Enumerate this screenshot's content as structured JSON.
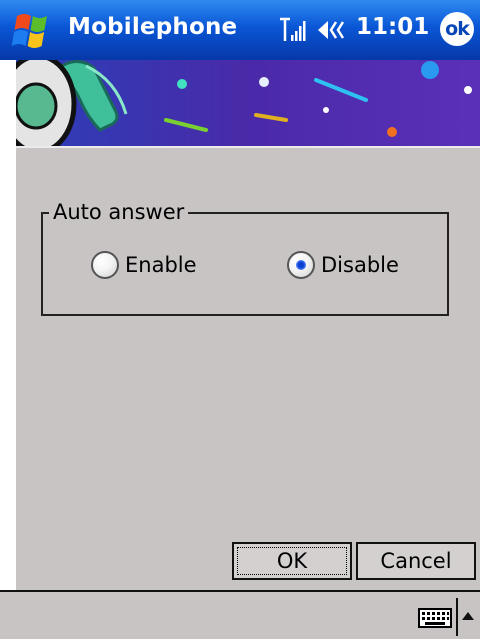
{
  "titlebar": {
    "app_title": "Mobilephone",
    "clock": "11:01",
    "ok_label": "ok",
    "icons": [
      "start-flag-icon",
      "signal-strength-icon",
      "volume-icon",
      "ok-icon"
    ]
  },
  "group": {
    "title": "Auto answer",
    "options": [
      {
        "label": "Enable",
        "checked": false
      },
      {
        "label": "Disable",
        "checked": true
      }
    ]
  },
  "buttons": {
    "ok_label": "OK",
    "cancel_label": "Cancel"
  },
  "bottombar": {
    "icons": [
      "keyboard-icon",
      "sip-arrow-icon"
    ]
  },
  "colors": {
    "titlebar": "#0a56d6",
    "content_bg": "#c8c4c4",
    "radio_dot": "#0b3fd0"
  }
}
